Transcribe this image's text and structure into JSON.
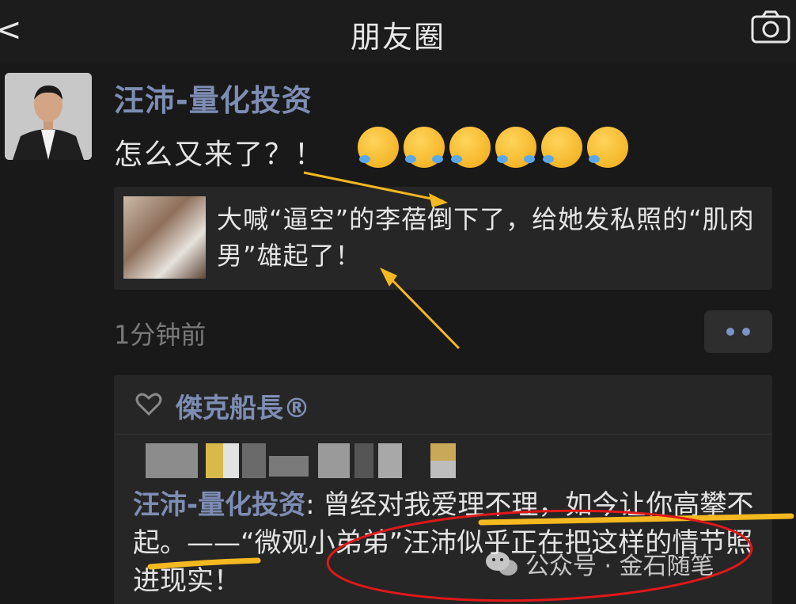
{
  "header": {
    "back_glyph": "<",
    "title": "朋友圈",
    "camera_icon": "camera-icon"
  },
  "post": {
    "author": "汪沛-量化投资",
    "text": "怎么又来了？！",
    "emoji_icons": [
      "crying-laughing-icon",
      "joy-icon",
      "crying-laughing-icon",
      "joy-icon",
      "crying-laughing-icon",
      "crying-laughing-icon"
    ],
    "link_card": {
      "title": "大喊“逼空”的李蓓倒下了，给她发私照的“肌肉男”雄起了！"
    },
    "time": "1分钟前"
  },
  "likes": {
    "names": "傑克船長®"
  },
  "comment": {
    "author": "汪沛-量化投资",
    "separator": ":",
    "text": "曾经对我爱理不理，如今让你高攀不起。——“微观小弟弟”汪沛似乎正在把这样的情节照进现实！"
  },
  "watermark": {
    "text": "公众号 · 金石随笔"
  },
  "colors": {
    "background": "#191919",
    "name_blue": "#7d8db4",
    "annotation_yellow": "#f5b820",
    "annotation_red": "#e01818"
  }
}
